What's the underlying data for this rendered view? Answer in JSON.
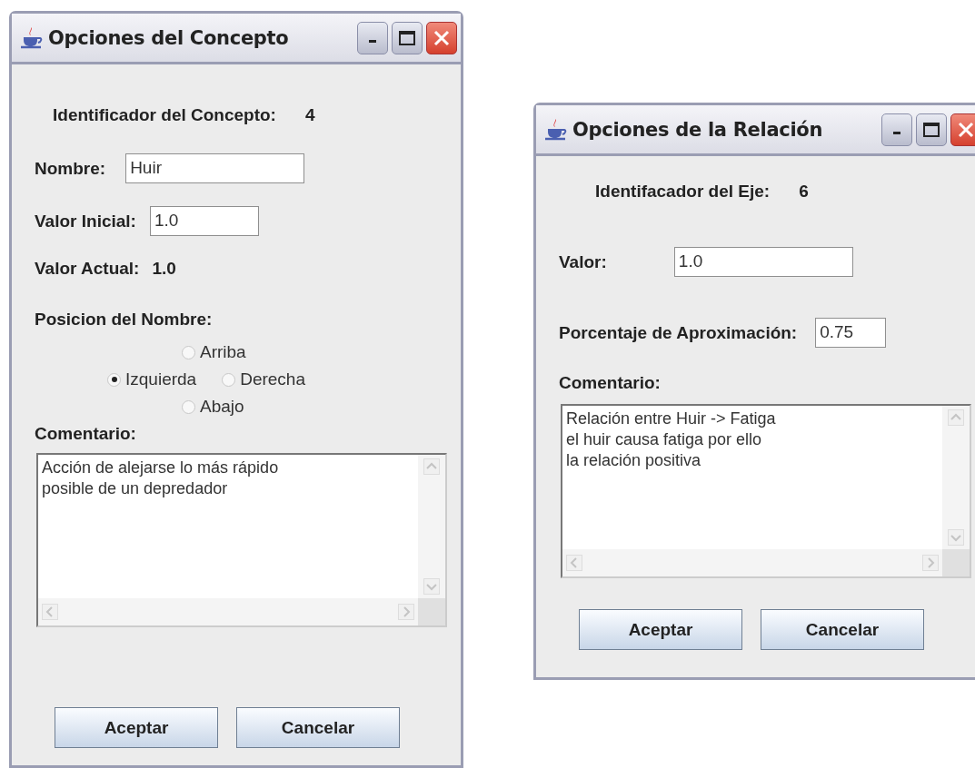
{
  "windows": [
    {
      "title": "Opciones del Concepto",
      "rows": [
        {
          "kind": "id",
          "label": "Identificador del Concepto:",
          "value": "4"
        },
        {
          "kind": "field",
          "label": "Nombre:",
          "value": "Huir"
        },
        {
          "kind": "field",
          "label": "Valor Inicial:",
          "value": "1.0"
        },
        {
          "kind": "value",
          "label": "Valor Actual:",
          "value": "1.0"
        },
        {
          "kind": "heading",
          "label": "Posicion del Nombre:"
        },
        {
          "kind": "radios",
          "options": [
            {
              "label": "Arriba",
              "selected": false
            },
            {
              "label": "Izquierda",
              "selected": true
            },
            {
              "label": "Derecha",
              "selected": false
            },
            {
              "label": "Abajo",
              "selected": false
            }
          ]
        },
        {
          "kind": "heading",
          "label": "Comentario:"
        },
        {
          "kind": "textarea",
          "value": "Acción de alejarse lo más rápido\nposible de un depredador"
        },
        {
          "kind": "buttons",
          "buttons": [
            "Aceptar",
            "Cancelar"
          ]
        }
      ]
    },
    {
      "title": "Opciones de la Relación",
      "rows": [
        {
          "kind": "id",
          "label": "Identifacador del Eje:",
          "value": "6"
        },
        {
          "kind": "field",
          "label": "Valor:",
          "value": "1.0"
        },
        {
          "kind": "field",
          "label": "Porcentaje de Aproximación:",
          "value": "0.75"
        },
        {
          "kind": "heading",
          "label": "Comentario:"
        },
        {
          "kind": "textarea",
          "value": "Relación entre Huir -> Fatiga\nel huir causa fatiga por ello\nla relación positiva"
        },
        {
          "kind": "buttons",
          "buttons": [
            "Aceptar",
            "Cancelar"
          ]
        }
      ]
    }
  ]
}
